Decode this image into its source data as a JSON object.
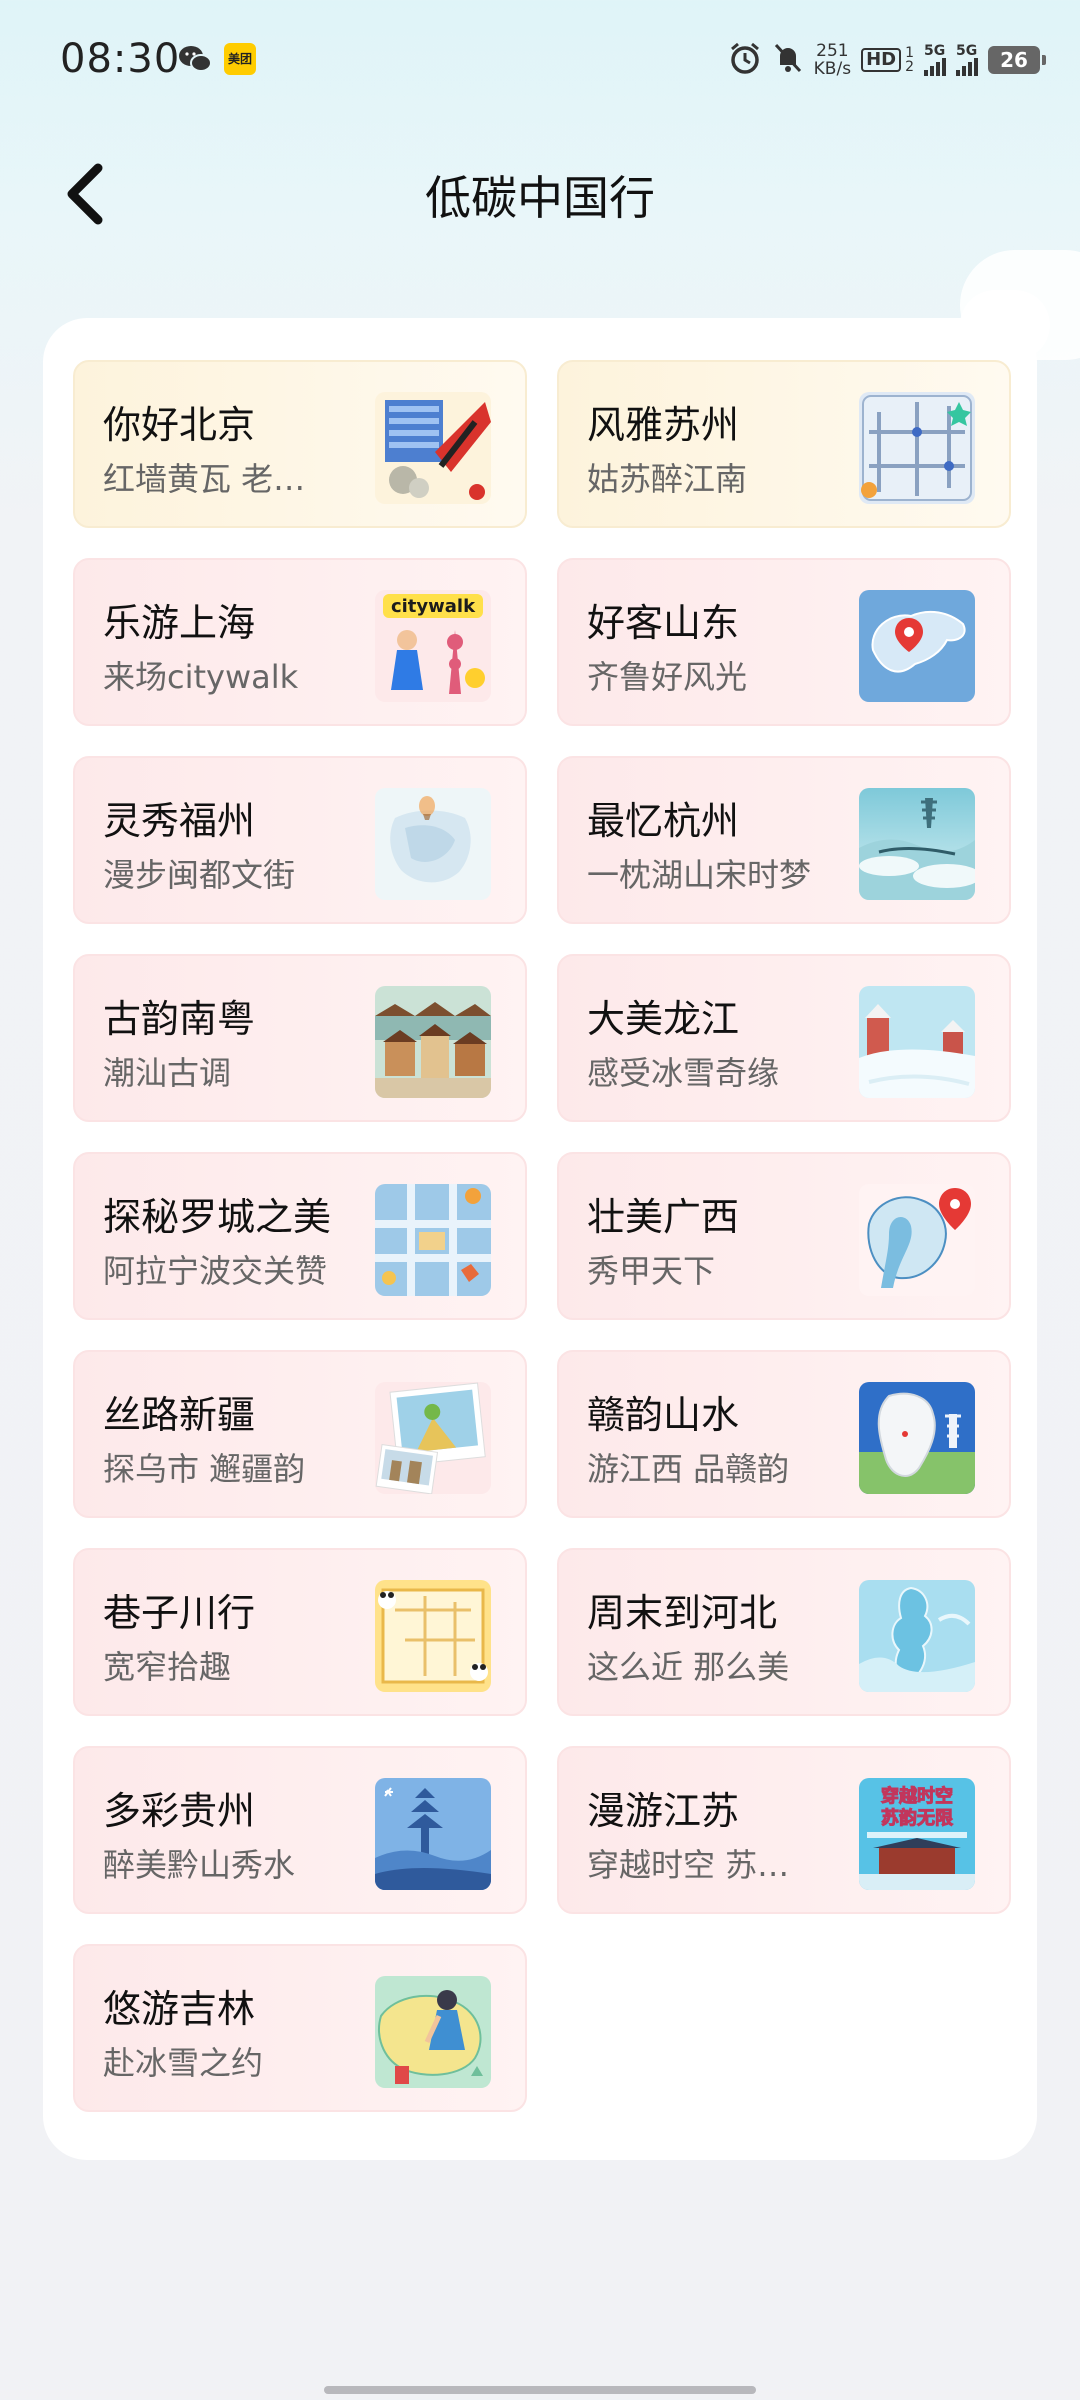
{
  "status_bar": {
    "time": "08:30",
    "meituan_label": "美团",
    "net_speed_value": "251",
    "net_speed_unit": "KB/s",
    "hd_label": "HD",
    "sim1": "1",
    "sim2": "2",
    "signal1_label": "5G",
    "signal2_label": "5G",
    "battery": "26"
  },
  "header": {
    "title": "低碳中国行"
  },
  "tiles": [
    {
      "title": "你好北京",
      "subtitle": "红墙黄瓦 老…",
      "style": "yellow",
      "thumb": "beijing-illustration"
    },
    {
      "title": "风雅苏州",
      "subtitle": "姑苏醉江南",
      "style": "yellow",
      "thumb": "suzhou-map"
    },
    {
      "title": "乐游上海",
      "subtitle": "来场citywalk",
      "style": "pink",
      "thumb": "shanghai-citywalk"
    },
    {
      "title": "好客山东",
      "subtitle": "齐鲁好风光",
      "style": "pink",
      "thumb": "shandong-map"
    },
    {
      "title": "灵秀福州",
      "subtitle": "漫步闽都文街",
      "style": "pink",
      "thumb": "fuzhou-map"
    },
    {
      "title": "最忆杭州",
      "subtitle": "一枕湖山宋时梦",
      "style": "pink",
      "thumb": "hangzhou-landscape"
    },
    {
      "title": "古韵南粤",
      "subtitle": "潮汕古调",
      "style": "pink",
      "thumb": "chaoshan-town"
    },
    {
      "title": "大美龙江",
      "subtitle": "感受冰雪奇缘",
      "style": "pink",
      "thumb": "snow-scene"
    },
    {
      "title": "探秘罗城之美",
      "subtitle": "阿拉宁波交关赞",
      "style": "pink",
      "thumb": "ningbo-map"
    },
    {
      "title": "壮美广西",
      "subtitle": "秀甲天下",
      "style": "pink",
      "thumb": "guangxi-map"
    },
    {
      "title": "丝路新疆",
      "subtitle": "探乌市 邂疆韵",
      "style": "pink",
      "thumb": "xinjiang-photos"
    },
    {
      "title": "赣韵山水",
      "subtitle": "游江西 品赣韵",
      "style": "pink",
      "thumb": "jiangxi-map"
    },
    {
      "title": "巷子川行",
      "subtitle": "宽窄拾趣",
      "style": "pink",
      "thumb": "sichuan-map"
    },
    {
      "title": "周末到河北",
      "subtitle": "这么近 那么美",
      "style": "pink",
      "thumb": "hebei-map"
    },
    {
      "title": "多彩贵州",
      "subtitle": "醉美黔山秀水",
      "style": "pink",
      "thumb": "guizhou-scene"
    },
    {
      "title": "漫游江苏",
      "subtitle": "穿越时空 苏…",
      "style": "pink",
      "thumb": "jiangsu-poster"
    },
    {
      "title": "悠游吉林",
      "subtitle": "赴冰雪之约",
      "style": "pink",
      "thumb": "jilin-map"
    }
  ],
  "thumb_text": {
    "shanghai_citywalk": "citywalk",
    "jiangsu_line1": "穿越时空",
    "jiangsu_line2": "苏韵无限"
  },
  "colors": {
    "tile_pink_bg": "#fde9ea",
    "tile_yellow_bg": "#fdf3dc",
    "accent_red": "#e53935"
  }
}
